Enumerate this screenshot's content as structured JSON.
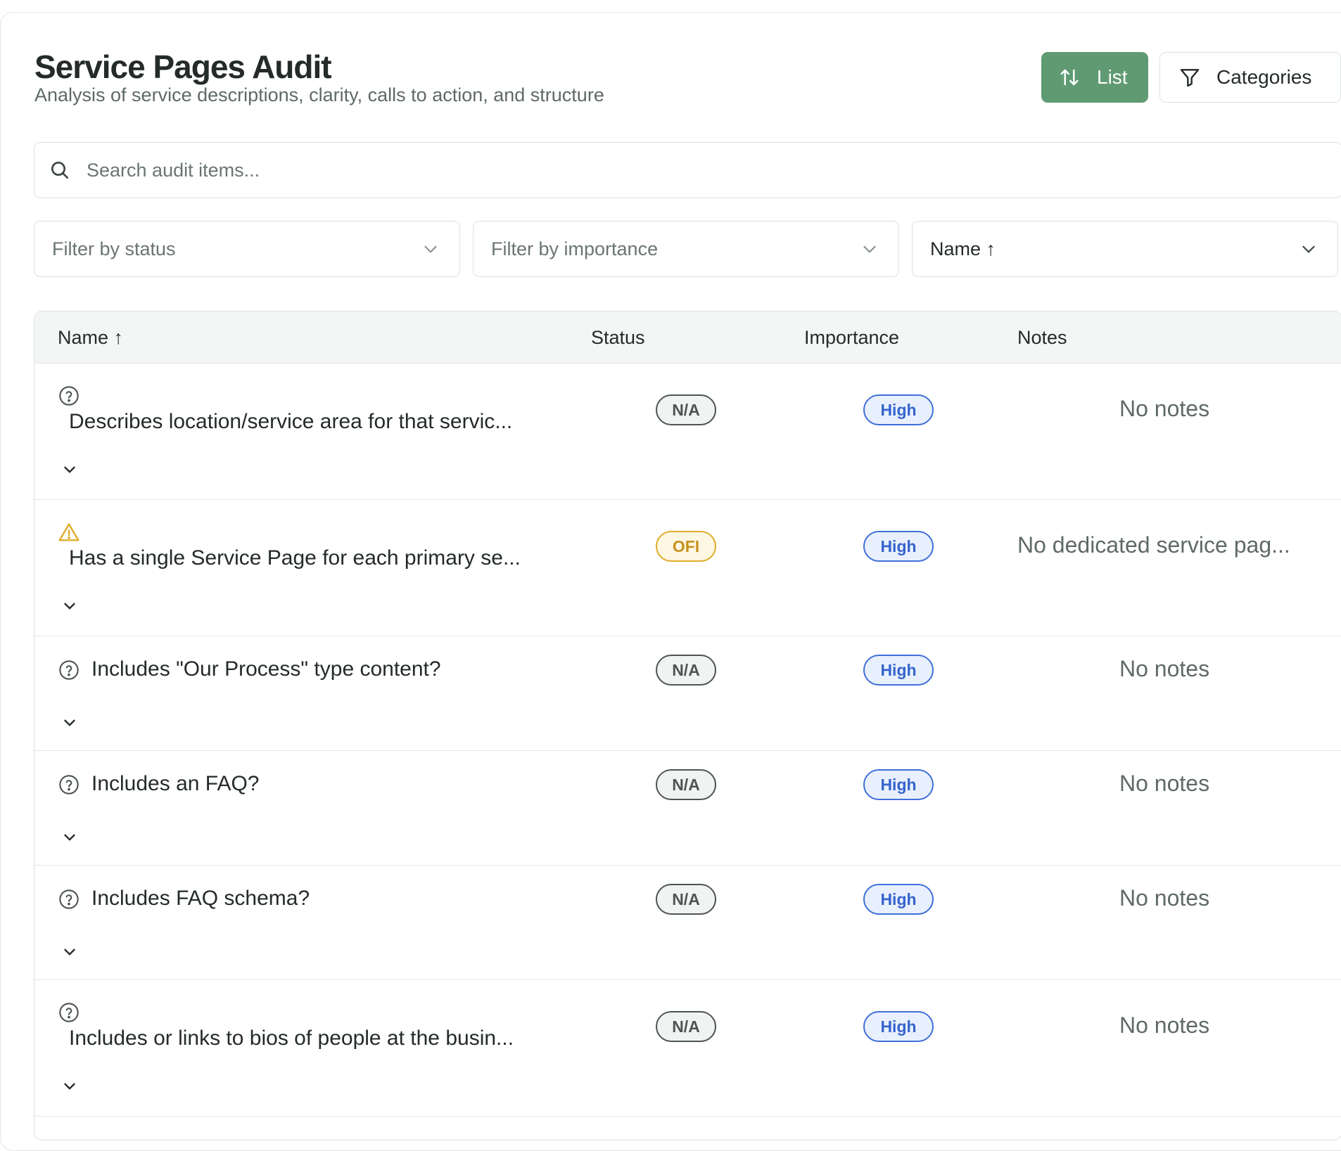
{
  "header": {
    "title": "Service Pages Audit",
    "subtitle": "Analysis of service descriptions, clarity, calls to action, and structure"
  },
  "toolbar": {
    "list_label": "List",
    "categories_label": "Categories"
  },
  "search": {
    "placeholder": "Search audit items..."
  },
  "filters": {
    "status_placeholder": "Filter by status",
    "importance_placeholder": "Filter by importance",
    "sort_value": "Name ↑"
  },
  "table": {
    "columns": {
      "name": "Name ↑",
      "status": "Status",
      "importance": "Importance",
      "notes": "Notes"
    },
    "rows": [
      {
        "status_icon": "help-circle-icon",
        "name": "Describes location/service area for that servic...",
        "status": "N/A",
        "importance": "High",
        "notes": "No notes"
      },
      {
        "status_icon": "warning-triangle-icon",
        "name": "Has a single Service Page for each primary se...",
        "status": "OFI",
        "importance": "High",
        "notes": "No dedicated service pag..."
      },
      {
        "status_icon": "help-circle-icon",
        "name": "Includes \"Our Process\" type content?",
        "status": "N/A",
        "importance": "High",
        "notes": "No notes"
      },
      {
        "status_icon": "help-circle-icon",
        "name": "Includes an FAQ?",
        "status": "N/A",
        "importance": "High",
        "notes": "No notes"
      },
      {
        "status_icon": "help-circle-icon",
        "name": "Includes FAQ schema?",
        "status": "N/A",
        "importance": "High",
        "notes": "No notes"
      },
      {
        "status_icon": "help-circle-icon",
        "name": "Includes or links to bios of people at the busin...",
        "status": "N/A",
        "importance": "High",
        "notes": "No notes"
      }
    ]
  },
  "colors": {
    "primary_button": "#5f9a73",
    "badge_na": "#4d5551",
    "badge_ofi": "#e0ad2a",
    "badge_high": "#3f6fd8"
  }
}
